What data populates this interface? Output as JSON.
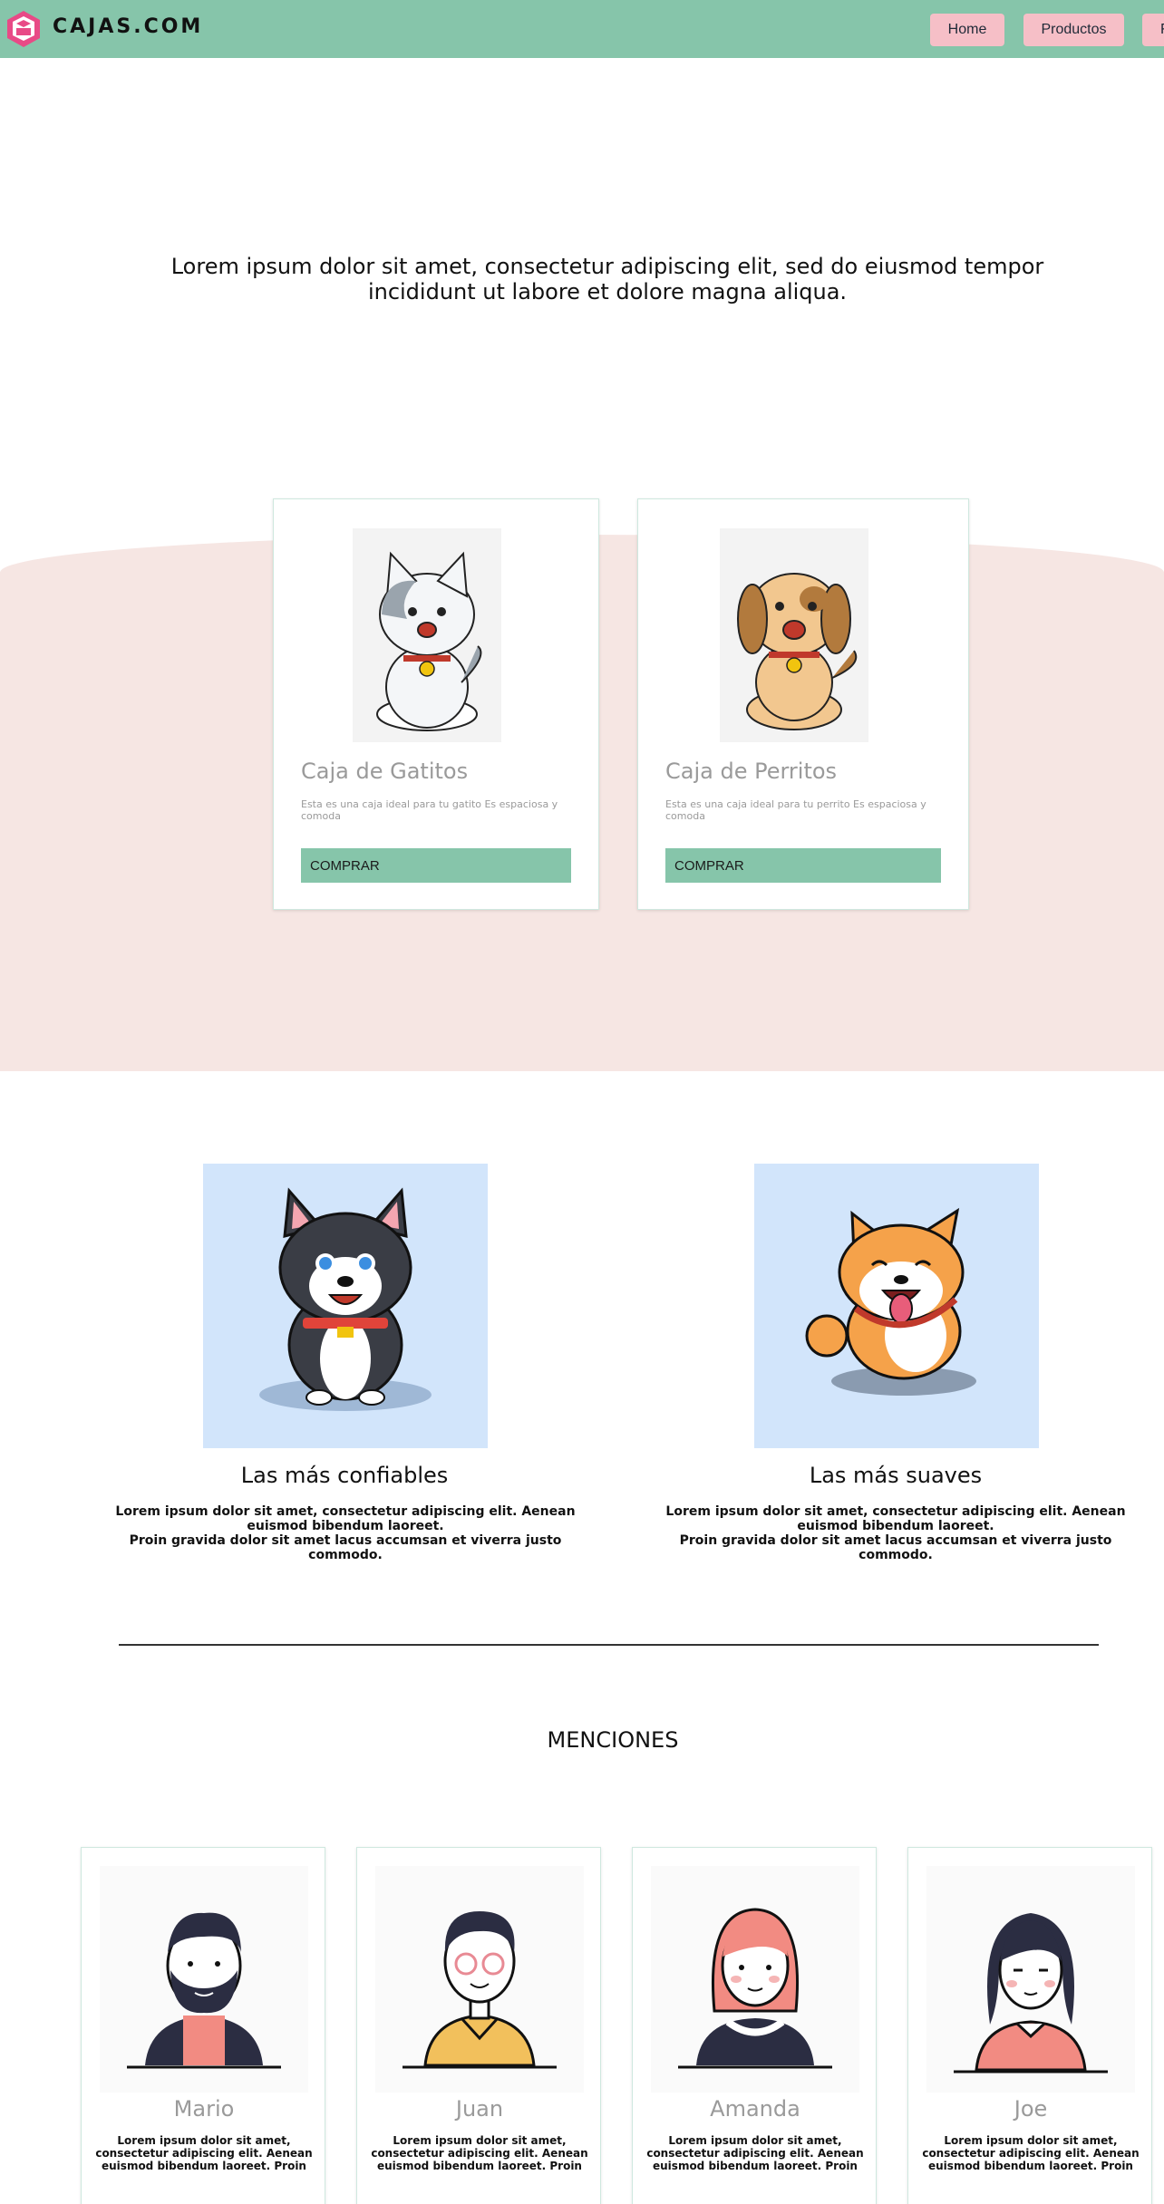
{
  "header": {
    "brand": "CAJAS.COM",
    "logo_icon": "box-logo-icon",
    "nav": [
      "Home",
      "Productos",
      "F"
    ]
  },
  "hero": {
    "text": "Lorem ipsum dolor sit amet, consectetur adipiscing elit, sed do eiusmod tempor incididunt ut labore et dolore magna aliqua."
  },
  "products": [
    {
      "title": "Caja de Gatitos",
      "description": "Esta es una caja ideal para tu gatito Es espaciosa y comoda",
      "button": "COMPRAR",
      "image": "cat-cartoon"
    },
    {
      "title": "Caja de Perritos",
      "description": "Esta es una caja ideal para tu perrito Es espaciosa y comoda",
      "button": "COMPRAR",
      "image": "dog-cartoon"
    }
  ],
  "features": [
    {
      "title": "Las más confiables",
      "text_line1": "Lorem ipsum dolor sit amet, consectetur adipiscing elit. Aenean euismod bibendum laoreet.",
      "text_line2": "Proin gravida dolor sit amet lacus accumsan et viverra justo commodo.",
      "image": "husky-cartoon"
    },
    {
      "title": "Las más suaves",
      "text_line1": "Lorem ipsum dolor sit amet, consectetur adipiscing elit. Aenean euismod bibendum laoreet.",
      "text_line2": "Proin gravida dolor sit amet lacus accumsan et viverra justo commodo.",
      "image": "shiba-cartoon"
    }
  ],
  "mentions": {
    "heading": "MENCIONES",
    "people": [
      {
        "name": "Mario",
        "text": "Lorem ipsum dolor sit amet, consectetur adipiscing elit. Aenean euismod bibendum laoreet. Proin"
      },
      {
        "name": "Juan",
        "text": "Lorem ipsum dolor sit amet, consectetur adipiscing elit. Aenean euismod bibendum laoreet. Proin"
      },
      {
        "name": "Amanda",
        "text": "Lorem ipsum dolor sit amet, consectetur adipiscing elit. Aenean euismod bibendum laoreet. Proin"
      },
      {
        "name": "Joe",
        "text": "Lorem ipsum dolor sit amet, consectetur adipiscing elit. Aenean euismod bibendum laoreet. Proin"
      }
    ]
  },
  "colors": {
    "header": "#86c5aa",
    "nav_button": "#f6bfc7",
    "pink_band": "#f6e6e3",
    "buy_button": "#86c5aa",
    "feature_bg": "#d2e5fb"
  }
}
